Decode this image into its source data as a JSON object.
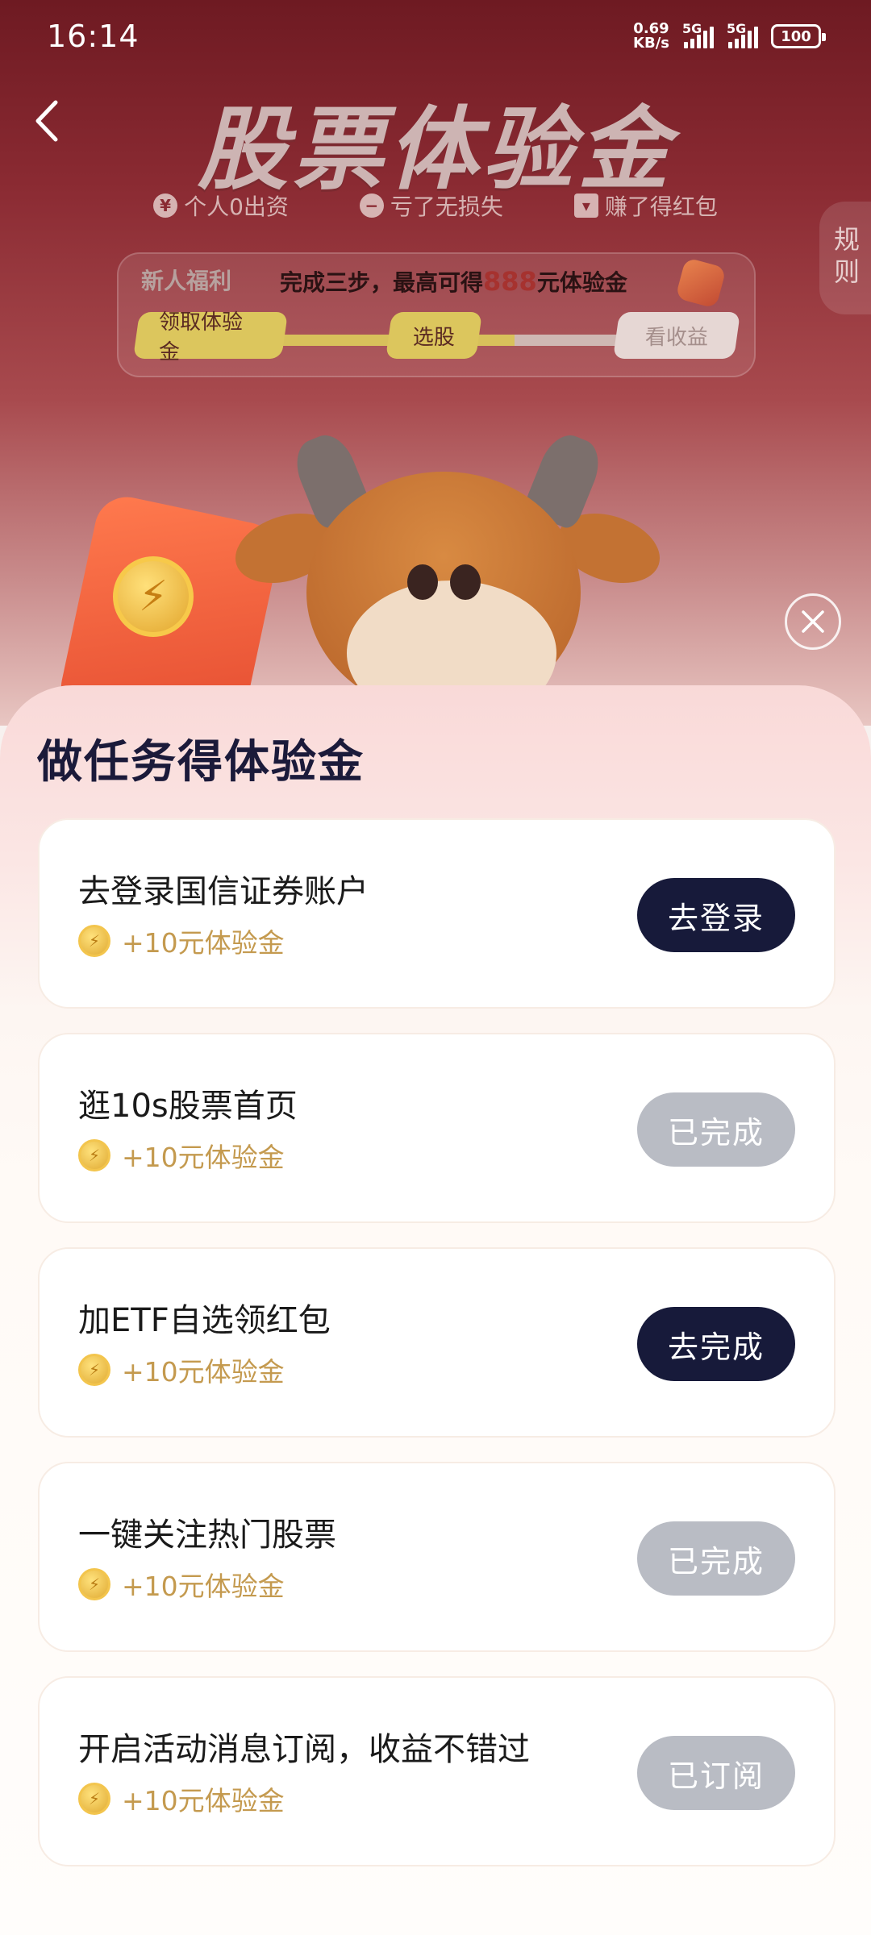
{
  "status_bar": {
    "time": "16:14",
    "net_speed_value": "0.69",
    "net_speed_unit": "KB/s",
    "signal1_label": "5G",
    "signal2_label": "5G",
    "battery": "100"
  },
  "header": {
    "title": "股票体验金",
    "perks": [
      "个人0出资",
      "亏了无损失",
      "赚了得红包"
    ],
    "perk_icons": [
      "¥",
      "−",
      "▾"
    ],
    "rules_label": "规则"
  },
  "welfare": {
    "tag": "新人福利",
    "desc_prefix": "完成三步，最高可得",
    "desc_amount": "888",
    "desc_suffix": "元体验金",
    "steps": [
      "领取体验金",
      "选股",
      "看收益"
    ],
    "progress": 0.65
  },
  "sheet": {
    "title": "做任务得体验金",
    "tasks": [
      {
        "name": "去登录国信证券账户",
        "reward": "+10元体验金",
        "button": "去登录",
        "state": "active"
      },
      {
        "name": "逛10s股票首页",
        "reward": "+10元体验金",
        "button": "已完成",
        "state": "done"
      },
      {
        "name": "加ETF自选领红包",
        "reward": "+10元体验金",
        "button": "去完成",
        "state": "active"
      },
      {
        "name": "一键关注热门股票",
        "reward": "+10元体验金",
        "button": "已完成",
        "state": "done"
      },
      {
        "name": "开启活动消息订阅，收益不错过",
        "reward": "+10元体验金",
        "button": "已订阅",
        "state": "done"
      }
    ]
  },
  "colors": {
    "brand_dark": "#171a3a",
    "done_gray": "#b9bcc4",
    "reward_gold": "#c49a4f",
    "hero_red": "#8a2a32"
  }
}
